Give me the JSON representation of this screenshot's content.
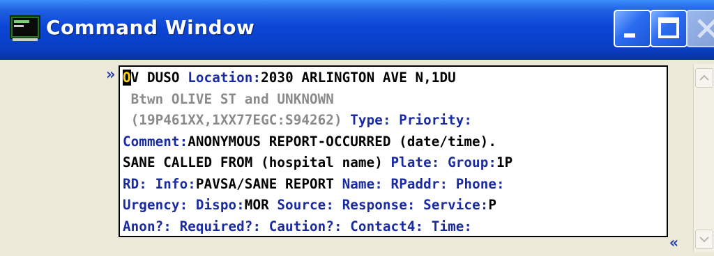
{
  "window": {
    "title": "Command Window",
    "icon": "command-window-icon"
  },
  "controls": {
    "minimize": "minimize-icon",
    "maximize": "maximize-icon",
    "close": "close-icon"
  },
  "markers": {
    "start": "»",
    "end": "«"
  },
  "console": {
    "line1": {
      "cursor": "O",
      "rest_cmd": "V DUSO ",
      "loc_label": "Location:",
      "loc_value": "2030 ARLINGTON AVE N,1DU"
    },
    "line2": {
      "text": " Btwn OLIVE ST and UNKNOWN"
    },
    "line3": {
      "text": " (19P461XX,1XX77EGC:S94262) ",
      "type_label": "Type:",
      "priority_label": " Priority:"
    },
    "line4": {
      "comment_label": "Comment:",
      "comment_value": "ANONYMOUS REPORT-OCCURRED (date/time)."
    },
    "line5": {
      "text": "SANE CALLED FROM (hospital name) ",
      "plate_label": "Plate:",
      "group_label": " Group:",
      "group_value": "1P"
    },
    "line6": {
      "rd_label": "RD:",
      "info_label": " Info:",
      "info_value": "PAVSA/SANE REPORT ",
      "name_label": "Name:",
      "rpaddr_label": " RPaddr:",
      "phone_label": " Phone:"
    },
    "line7": {
      "urgency_label": "Urgency:",
      "dispo_label": " Dispo:",
      "dispo_value": "MOR ",
      "source_label": "Source:",
      "response_label": " Response:",
      "service_label": " Service:",
      "service_value": "P"
    },
    "line8": {
      "anon_label": "Anon?:",
      "required_label": " Required?:",
      "caution_label": " Caution?:",
      "contact_label": " Contact4:",
      "time_label": " Time:"
    }
  },
  "colors": {
    "title_bar": "#0a3fc4",
    "label_blue": "#1a2aa0",
    "value_black": "#000000",
    "address_gray": "#8a8a8a",
    "cursor_fg": "#ffd400"
  }
}
